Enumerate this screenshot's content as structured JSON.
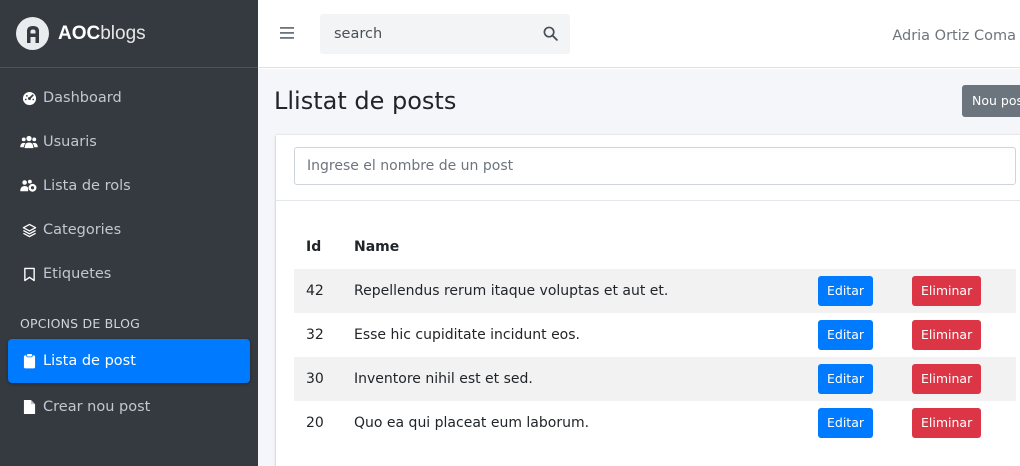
{
  "brand": {
    "bold": "AOC",
    "rest": "blogs"
  },
  "sidebar": {
    "items": [
      {
        "label": "Dashboard",
        "icon": "tachometer-icon"
      },
      {
        "label": "Usuaris",
        "icon": "users-icon"
      },
      {
        "label": "Lista de rols",
        "icon": "users-cog-icon"
      },
      {
        "label": "Categories",
        "icon": "layer-group-icon"
      },
      {
        "label": "Etiquetes",
        "icon": "bookmark-icon"
      }
    ],
    "section_header": "OPCIONS DE BLOG",
    "blog_items": [
      {
        "label": "Lista de post",
        "icon": "clipboard-icon",
        "active": true
      },
      {
        "label": "Crear nou post",
        "icon": "file-icon",
        "active": false
      }
    ]
  },
  "topbar": {
    "search_placeholder": "search",
    "user_name": "Adria Ortiz Coma"
  },
  "main": {
    "title": "Llistat de posts",
    "new_post_label": "Nou post",
    "filter_placeholder": "Ingrese el nombre de un post",
    "table": {
      "headers": {
        "id": "Id",
        "name": "Name"
      },
      "edit_label": "Editar",
      "delete_label": "Eliminar",
      "rows": [
        {
          "id": "42",
          "name": "Repellendus rerum itaque voluptas et aut et."
        },
        {
          "id": "32",
          "name": "Esse hic cupiditate incidunt eos."
        },
        {
          "id": "30",
          "name": "Inventore nihil est et sed."
        },
        {
          "id": "20",
          "name": "Quo ea qui placeat eum laborum."
        }
      ]
    }
  },
  "colors": {
    "sidebar_bg": "#343a40",
    "primary": "#007bff",
    "danger": "#dc3545",
    "secondary": "#6c757d",
    "content_bg": "#f4f6f9"
  }
}
